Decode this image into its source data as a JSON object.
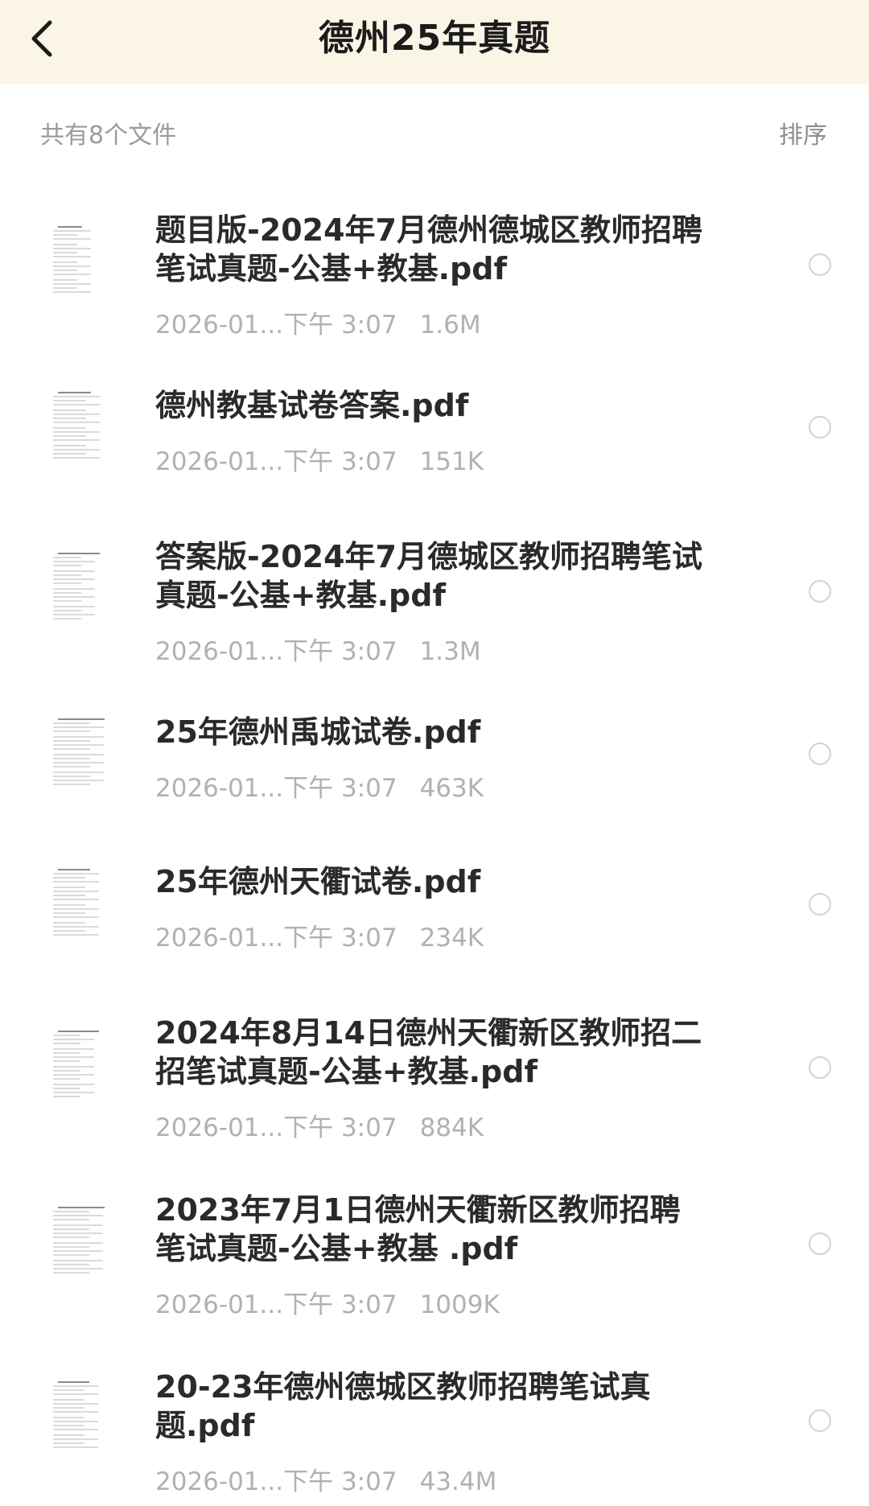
{
  "header": {
    "title": "德州25年真题"
  },
  "toolbar": {
    "file_count": "共有8个文件",
    "sort_label": "排序"
  },
  "files": [
    {
      "name": "题目版-2024年7月德州德城区教师招聘笔试真题-公基+教基.pdf",
      "date": "2026-01...下午 3:07",
      "size": "1.6M"
    },
    {
      "name": "德州教基试卷答案.pdf",
      "date": "2026-01...下午 3:07",
      "size": "151K"
    },
    {
      "name": "答案版-2024年7月德城区教师招聘笔试真题-公基+教基.pdf",
      "date": "2026-01...下午 3:07",
      "size": "1.3M"
    },
    {
      "name": "25年德州禹城试卷.pdf",
      "date": "2026-01...下午 3:07",
      "size": "463K"
    },
    {
      "name": "25年德州天衢试卷.pdf",
      "date": "2026-01...下午 3:07",
      "size": "234K"
    },
    {
      "name": "2024年8月14日德州天衢新区教师招二招笔试真题-公基+教基.pdf",
      "date": "2026-01...下午 3:07",
      "size": "884K"
    },
    {
      "name": "2023年7月1日德州天衢新区教师招聘笔试真题-公基+教基 .pdf",
      "date": "2026-01...下午 3:07",
      "size": "1009K"
    },
    {
      "name": "20-23年德州德城区教师招聘笔试真题.pdf",
      "date": "2026-01...下午 3:07",
      "size": "43.4M"
    }
  ]
}
